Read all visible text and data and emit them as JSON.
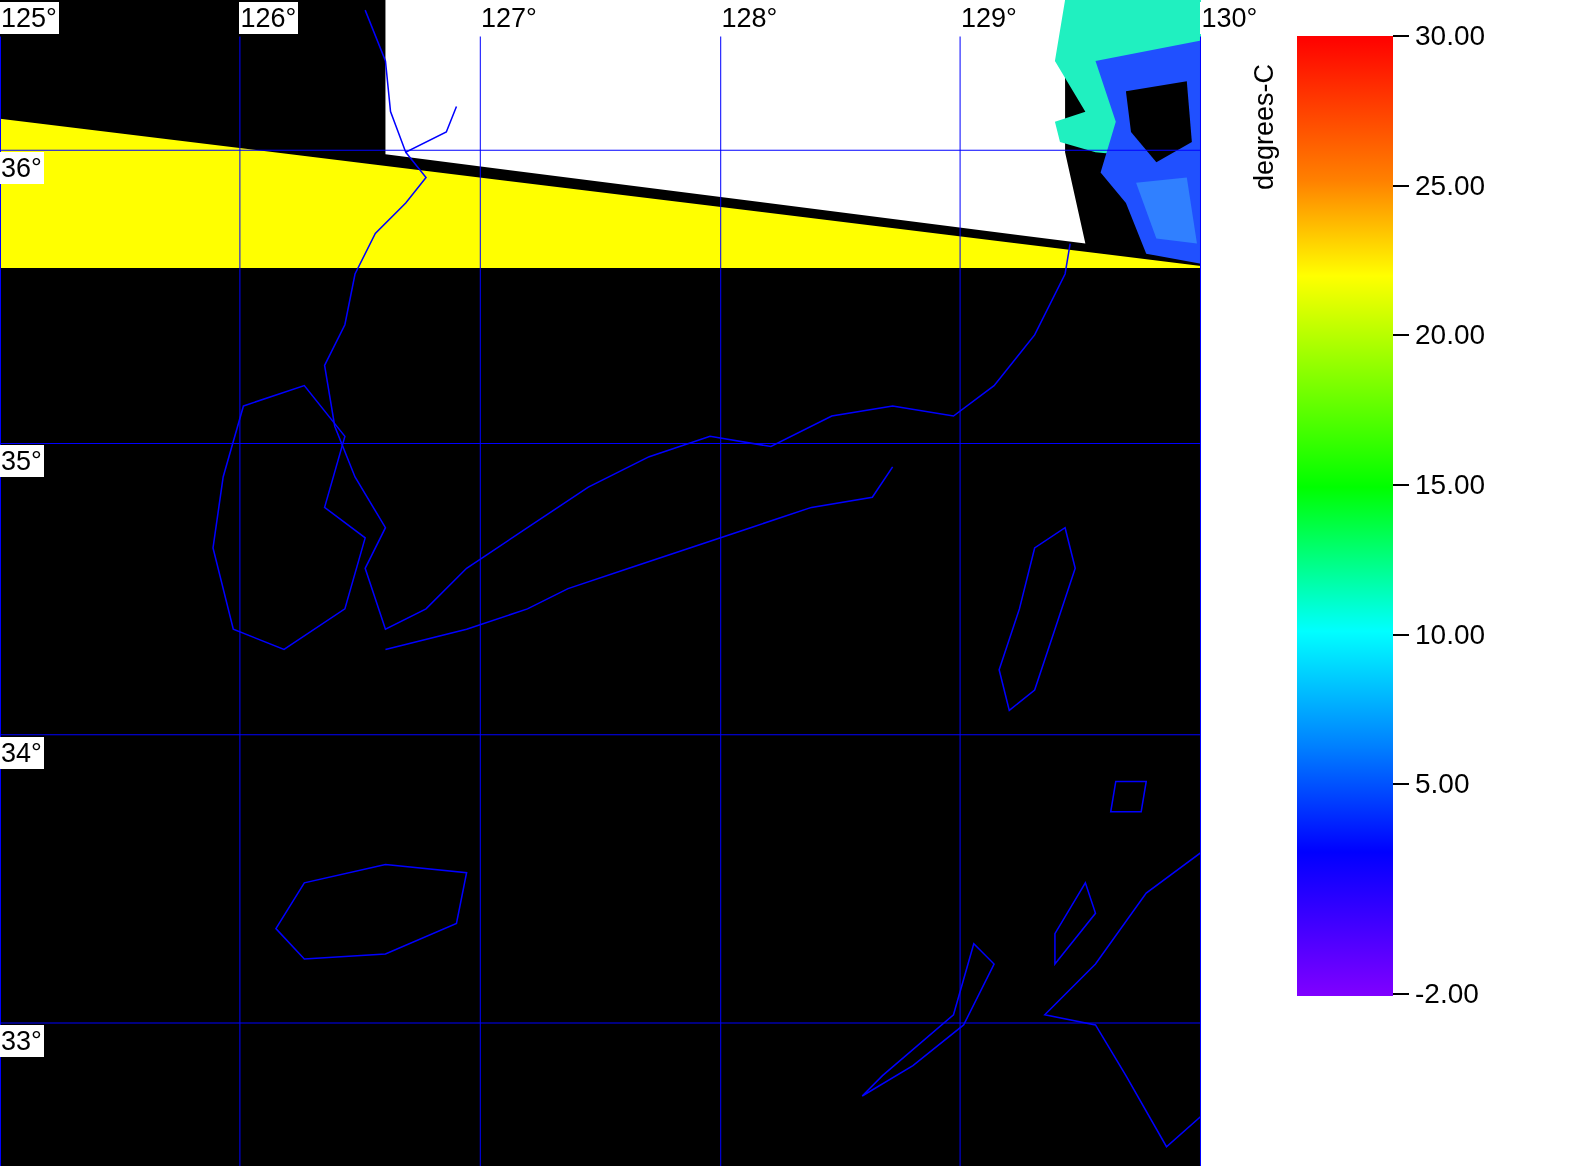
{
  "map": {
    "longitude_labels": [
      "125°",
      "126°",
      "127°",
      "128°",
      "129°",
      "130°"
    ],
    "latitude_labels": [
      "36°",
      "35°",
      "34°",
      "33°"
    ]
  },
  "colorbar": {
    "title": "degrees-C",
    "labels": [
      "30.00",
      "25.00",
      "20.00",
      "15.00",
      "10.00",
      "5.00",
      "-2.00"
    ]
  }
}
